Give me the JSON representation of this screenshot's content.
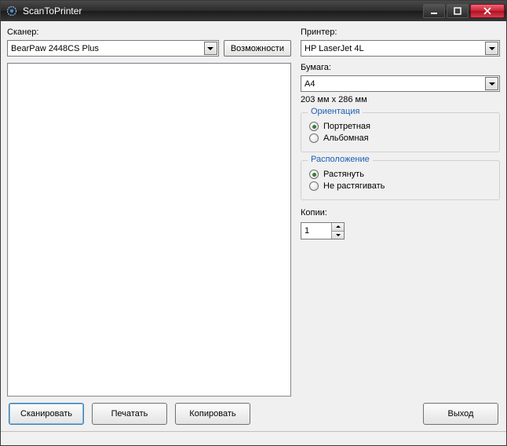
{
  "window": {
    "title": "ScanToPrinter"
  },
  "scanner": {
    "label": "Сканер:",
    "value": "BearPaw 2448CS Plus",
    "capabilities_btn": "Возможности"
  },
  "printer": {
    "label": "Принтер:",
    "value": "HP LaserJet 4L"
  },
  "paper": {
    "label": "Бумага:",
    "value": "A4",
    "dimensions": "203 мм x 286 мм"
  },
  "orientation": {
    "legend": "Ориентация",
    "portrait": "Портретная",
    "landscape": "Альбомная",
    "selected": "portrait"
  },
  "placement": {
    "legend": "Расположение",
    "stretch": "Растянуть",
    "nostretch": "Не растягивать",
    "selected": "stretch"
  },
  "copies": {
    "label": "Копии:",
    "value": "1"
  },
  "buttons": {
    "scan": "Сканировать",
    "print": "Печатать",
    "copy": "Копировать",
    "exit": "Выход"
  }
}
